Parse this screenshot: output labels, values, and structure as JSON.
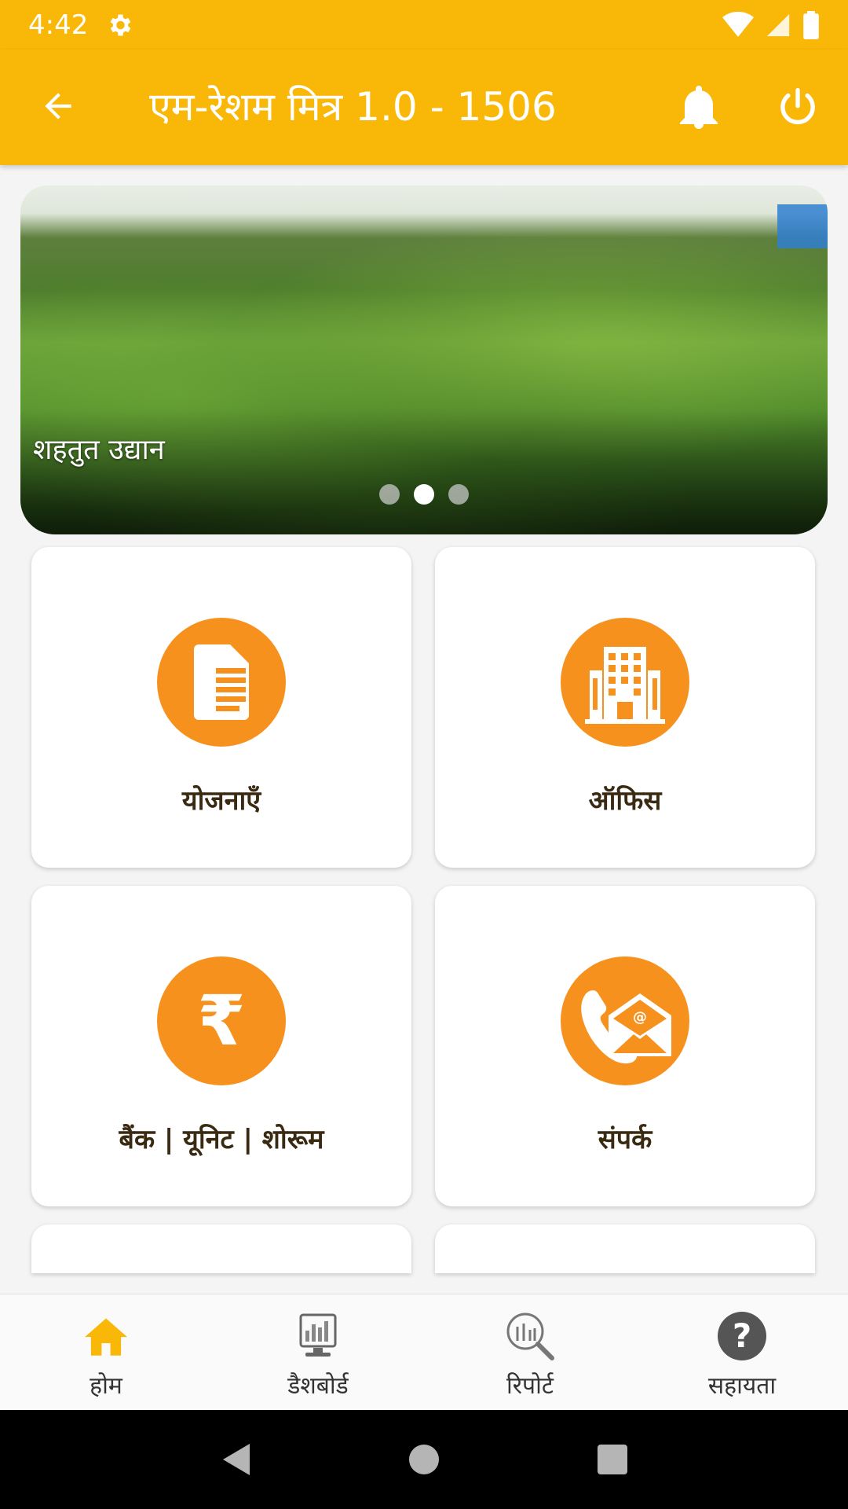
{
  "status_bar": {
    "time": "4:42"
  },
  "app_bar": {
    "title": "एम-रेशम मित्र 1.0 - 1506"
  },
  "banner": {
    "caption": "शहतुत उद्यान",
    "slide_count": 3,
    "active_slide": 2
  },
  "tiles": [
    {
      "label": "योजनाएँ",
      "icon": "document-icon"
    },
    {
      "label": "ऑफिस",
      "icon": "office-building-icon"
    },
    {
      "label": "बैंक | यूनिट | शोरूम",
      "icon": "rupee-icon",
      "icon_text": "₹"
    },
    {
      "label": "संपर्क",
      "icon": "contact-mail-phone-icon"
    }
  ],
  "bottom_nav": {
    "items": [
      {
        "label": "होम",
        "icon": "home-icon",
        "active": true
      },
      {
        "label": "डैशबोर्ड",
        "icon": "dashboard-monitor-icon",
        "active": false
      },
      {
        "label": "रिपोर्ट",
        "icon": "report-search-icon",
        "active": false
      },
      {
        "label": "सहायता",
        "icon": "help-icon",
        "active": false
      }
    ]
  },
  "colors": {
    "primary": "#f9b707",
    "accent": "#f7911e",
    "label_text": "#3a2a12"
  }
}
